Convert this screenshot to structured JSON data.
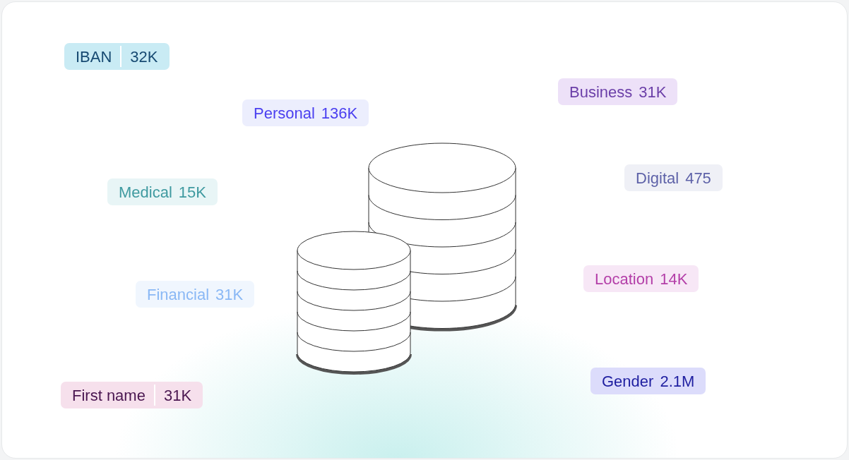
{
  "tags": [
    {
      "label": "IBAN",
      "value": "32K",
      "divided": true,
      "color": "#174a72"
    },
    {
      "label": "Business",
      "value": "31K",
      "divided": false,
      "color": "#6b3fa8"
    },
    {
      "label": "Personal",
      "value": "136K",
      "divided": false,
      "color": "#4a3ff0"
    },
    {
      "label": "Digital",
      "value": "475",
      "divided": false,
      "color": "#5e62a8"
    },
    {
      "label": "Medical",
      "value": "15K",
      "divided": false,
      "color": "#3f9aa0"
    },
    {
      "label": "Location",
      "value": "14K",
      "divided": false,
      "color": "#b33ea8"
    },
    {
      "label": "Financial",
      "value": "31K",
      "divided": false,
      "color": "#8ab8f5"
    },
    {
      "label": "Gender",
      "value": "2.1M",
      "divided": false,
      "color": "#1e1ea0"
    },
    {
      "label": "First name",
      "value": "31K",
      "divided": true,
      "color": "#4a1650"
    }
  ]
}
